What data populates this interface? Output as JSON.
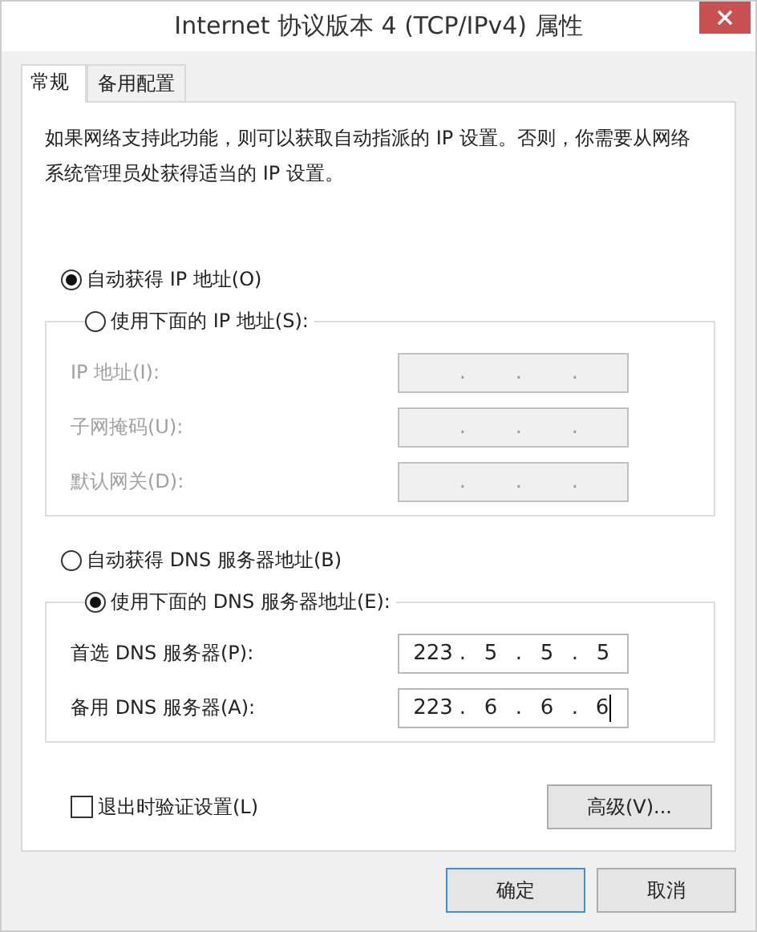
{
  "window": {
    "title": "Internet 协议版本 4 (TCP/IPv4) 属性"
  },
  "tabs": [
    {
      "label": "常规",
      "selected": true
    },
    {
      "label": "备用配置",
      "selected": false
    }
  ],
  "description": "如果网络支持此功能，则可以获取自动指派的 IP 设置。否则，你需要从网络系统管理员处获得适当的 IP 设置。",
  "ip": {
    "options": [
      {
        "label": "自动获得 IP 地址(O)",
        "selected": true
      },
      {
        "label": "使用下面的 IP 地址(S):",
        "selected": false
      }
    ],
    "fields": [
      {
        "label": "IP 地址(I):",
        "disabled": true,
        "caret": false,
        "separators": [
          ".",
          ".",
          "."
        ]
      },
      {
        "label": "子网掩码(U):",
        "disabled": true,
        "caret": false,
        "separators": [
          ".",
          ".",
          "."
        ]
      },
      {
        "label": "默认网关(D):",
        "disabled": true,
        "caret": false,
        "separators": [
          ".",
          ".",
          "."
        ]
      }
    ]
  },
  "dns": {
    "options": [
      {
        "label": "自动获得 DNS 服务器地址(B)",
        "selected": false
      },
      {
        "label": "使用下面的 DNS 服务器地址(E):",
        "selected": true
      }
    ],
    "fields": [
      {
        "label": "首选 DNS 服务器(P):",
        "disabled": false,
        "caret": false,
        "octets": [
          "223",
          "5",
          "5",
          "5"
        ],
        "separators": [
          ".",
          ".",
          "."
        ]
      },
      {
        "label": "备用 DNS 服务器(A):",
        "disabled": false,
        "caret": true,
        "octets": [
          "223",
          "6",
          "6",
          "6"
        ],
        "separators": [
          ".",
          ".",
          "."
        ]
      }
    ]
  },
  "validate_checkbox": {
    "label": "退出时验证设置(L)",
    "checked": false
  },
  "advanced_button": "高级(V)...",
  "buttons": [
    {
      "label": "确定",
      "default": true
    },
    {
      "label": "取消",
      "default": false
    }
  ]
}
